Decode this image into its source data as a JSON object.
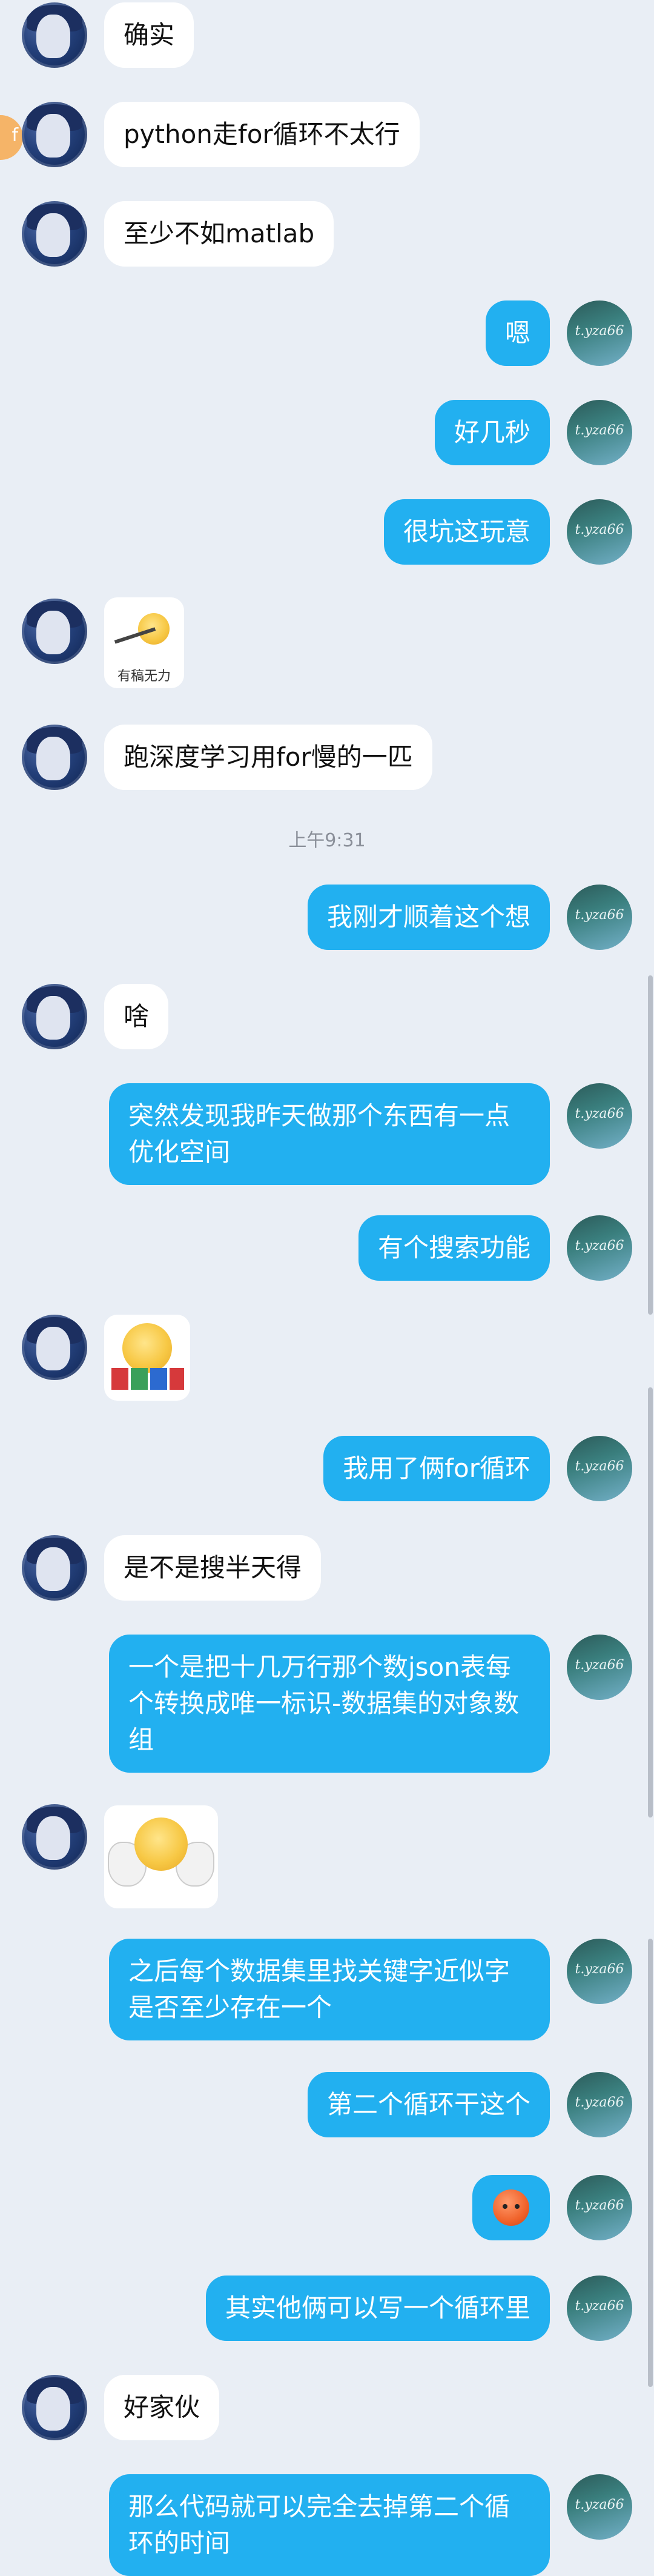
{
  "messages": [
    {
      "side": "left",
      "text": "确实"
    },
    {
      "side": "left",
      "text": "python走for循环不太行"
    },
    {
      "side": "left",
      "text": "至少不如matlab"
    },
    {
      "side": "right",
      "text": "嗯"
    },
    {
      "side": "right",
      "text": "好几秒"
    },
    {
      "side": "right",
      "text": "很坑这玩意"
    },
    {
      "side": "left",
      "sticker": "有稿无力"
    },
    {
      "side": "left",
      "text": "跑深度学习用for慢的一匹"
    },
    {
      "side": "right",
      "text": "我刚才顺着这个想"
    },
    {
      "side": "left",
      "text": "啥"
    },
    {
      "side": "right",
      "text": "突然发现我昨天做那个东西有一点优化空间"
    },
    {
      "side": "right",
      "text": "有个搜索功能"
    },
    {
      "side": "left",
      "sticker": ""
    },
    {
      "side": "right",
      "text": "我用了俩for循环"
    },
    {
      "side": "left",
      "text": "是不是搜半天得"
    },
    {
      "side": "right",
      "text": "一个是把十几万行那个数json表每个转换成唯一标识-数据集的对象数组"
    },
    {
      "side": "left",
      "sticker": ""
    },
    {
      "side": "right",
      "text": "之后每个数据集里找关键字近似字是否至少存在一个"
    },
    {
      "side": "right",
      "text": "第二个循环干这个"
    },
    {
      "side": "right",
      "emoji": "orange-face"
    },
    {
      "side": "right",
      "text": "其实他俩可以写一个循环里"
    },
    {
      "side": "left",
      "text": "好家伙"
    },
    {
      "side": "right",
      "text": "那么代码就可以完全去掉第二个循环的时间"
    }
  ],
  "timestamp": "上午9:31",
  "my_avatar_text": "t.yza66",
  "edge_avatar_text": "f",
  "colors": {
    "background": "#e9eef5",
    "self_bubble": "#22b0f0",
    "other_bubble": "#ffffff"
  }
}
